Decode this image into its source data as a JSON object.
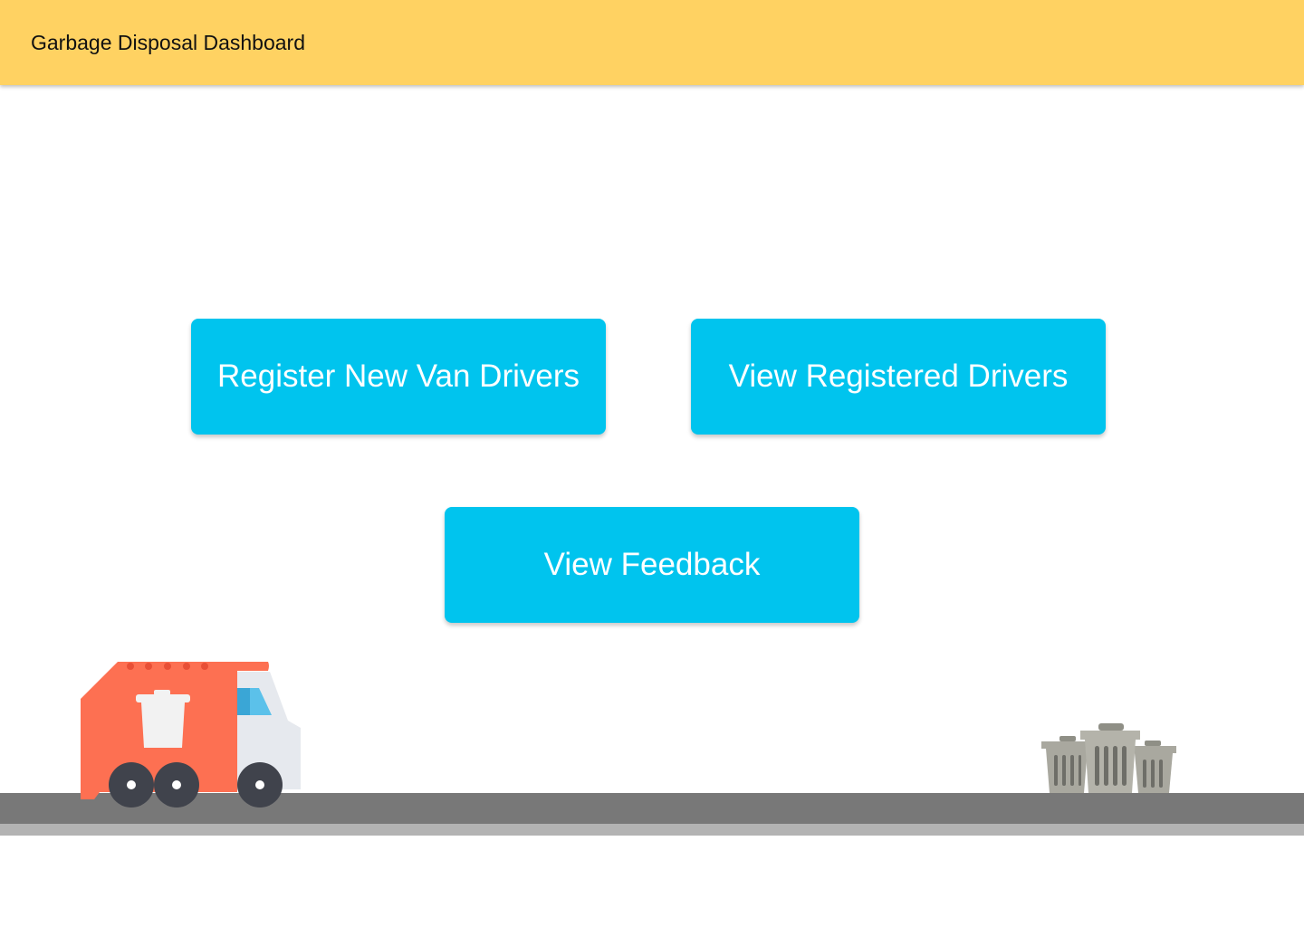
{
  "header": {
    "title": "Garbage Disposal Dashboard",
    "background_color": "#ffd262"
  },
  "actions": {
    "register_label": "Register New Van Drivers",
    "view_drivers_label": "View Registered Drivers",
    "feedback_label": "View Feedback",
    "button_color": "#00c4ee"
  },
  "illustration": {
    "icons": [
      "garbage-truck-icon",
      "trash-cans-icon",
      "road"
    ],
    "truck_color": "#fd7052",
    "road_color": "#787878"
  }
}
